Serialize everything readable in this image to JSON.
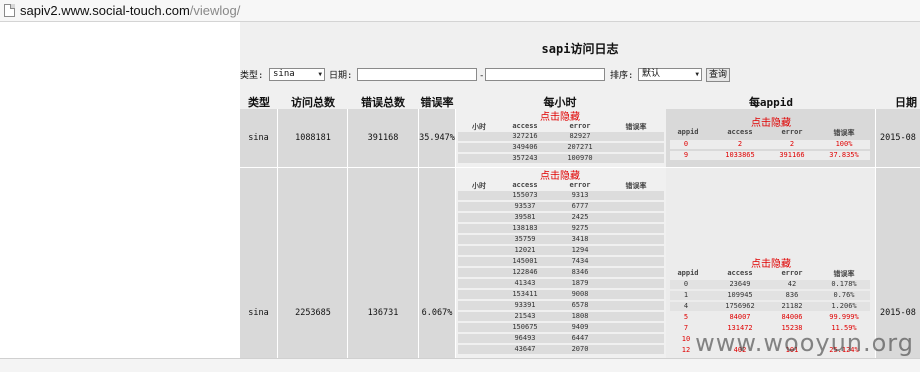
{
  "browser": {
    "url_host": "sapiv2.www.social-touch.com",
    "url_path": "/viewlog/"
  },
  "page": {
    "title": "sapi访问日志",
    "filter": {
      "type_label": "类型:",
      "type_value": "sina",
      "date_label": "日期:",
      "date_sep": "-",
      "sort_label": "排序:",
      "sort_value": "默认",
      "query_button": "查询"
    },
    "columns": [
      "类型",
      "访问总数",
      "错误总数",
      "错误率",
      "每小时",
      "每appid",
      "日期"
    ],
    "hide_toggle": "点击隐藏",
    "hourly_subheaders": [
      "小时",
      "access",
      "error",
      "错误率"
    ],
    "app_subheaders": [
      "appid",
      "access",
      "error",
      "错误率"
    ],
    "rows": [
      {
        "type": "sina",
        "total": "1088181",
        "errors": "391168",
        "rate": "35.947%",
        "date": "2015-08",
        "hourly": [
          {
            "access": "327216",
            "error": "82927"
          },
          {
            "access": "349406",
            "error": "207271"
          },
          {
            "access": "357243",
            "error": "100970"
          }
        ],
        "apps": [
          {
            "appid": "0",
            "access": "2",
            "error": "2",
            "rate": "100%",
            "alert": true
          },
          {
            "appid": "9",
            "access": "1033865",
            "error": "391166",
            "rate": "37.835%",
            "alert": true
          }
        ]
      },
      {
        "type": "sina",
        "total": "2253685",
        "errors": "136731",
        "rate": "6.067%",
        "date": "2015-08",
        "hourly": [
          {
            "access": "155073",
            "error": "9313"
          },
          {
            "access": "93537",
            "error": "6777"
          },
          {
            "access": "39581",
            "error": "2425"
          },
          {
            "access": "138183",
            "error": "9275"
          },
          {
            "access": "35759",
            "error": "3418"
          },
          {
            "access": "12021",
            "error": "1294"
          },
          {
            "access": "145001",
            "error": "7434"
          },
          {
            "access": "122846",
            "error": "8346"
          },
          {
            "access": "41343",
            "error": "1879"
          },
          {
            "access": "153411",
            "error": "9008"
          },
          {
            "access": "93391",
            "error": "6578"
          },
          {
            "access": "21543",
            "error": "1808"
          },
          {
            "access": "150675",
            "error": "9409"
          },
          {
            "access": "96493",
            "error": "6447"
          },
          {
            "access": "43647",
            "error": "2070"
          }
        ],
        "apps": [
          {
            "appid": "0",
            "access": "23649",
            "error": "42",
            "rate": "0.178%",
            "alert": false
          },
          {
            "appid": "1",
            "access": "109945",
            "error": "836",
            "rate": "0.76%",
            "alert": false
          },
          {
            "appid": "4",
            "access": "1756962",
            "error": "21182",
            "rate": "1.206%",
            "alert": false
          },
          {
            "appid": "5",
            "access": "84007",
            "error": "84006",
            "rate": "99.999%",
            "alert": true
          },
          {
            "appid": "7",
            "access": "131472",
            "error": "15238",
            "rate": "11.59%",
            "alert": true
          },
          {
            "appid": "10",
            "access": "",
            "error": "",
            "rate": "",
            "alert": true
          },
          {
            "appid": "12",
            "access": "402",
            "error": "101",
            "rate": "25.124%",
            "alert": true
          }
        ]
      }
    ]
  },
  "watermark": "www.wooyun.org",
  "colors": {
    "alert": "#e00000",
    "row_bg": "#d9d9d9",
    "page_bg": "#f0f0f0"
  }
}
